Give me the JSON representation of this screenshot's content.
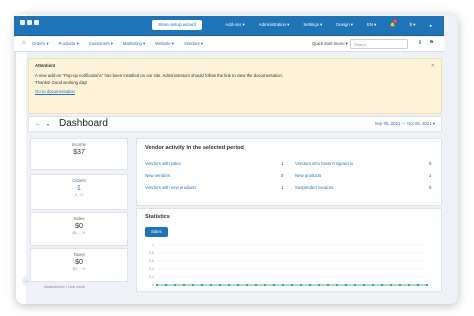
{
  "topbar": {
    "setup_button": "Store setup wizard",
    "items": [
      "Add-ons ▾",
      "Administration ▾",
      "Settings ▾",
      "Design ▾",
      "EN ▾"
    ],
    "currency": "$ ▾",
    "notification_count": "1"
  },
  "nav": {
    "items": [
      "Orders ▾",
      "Products ▾",
      "Customers ▾",
      "Marketing ▾",
      "Website ▾",
      "Vendors ▾"
    ],
    "quick_menu": "Quick start menu ▾",
    "search_placeholder": "Search"
  },
  "notice": {
    "title": "Attention!",
    "line1": "A new add-on \"Pop-up notifications\" has been installed on our site. Administrators should follow the link to view the documentation.",
    "line2": "Thanks! Good working day!",
    "link": "Go to documentation"
  },
  "dashboard": {
    "title": "Dashboard",
    "date_range": "Sep 05, 2021 — Oct 05, 2021 ▾"
  },
  "stats": [
    {
      "label": "Income",
      "value": "$37",
      "sub": ""
    },
    {
      "label": "Orders",
      "value": "1",
      "sub": "0, +1"
    },
    {
      "label": "Sales",
      "value": "$0",
      "sub": "$0, ...%"
    },
    {
      "label": "Taxes",
      "value": "$0",
      "sub": "$0, ...%"
    }
  ],
  "vendor_activity": {
    "title": "Vendor activity in the selected period",
    "rows_left": [
      {
        "label": "Vendors with sales",
        "value": "1"
      },
      {
        "label": "New vendors",
        "value": "0"
      },
      {
        "label": "Vendors with new products",
        "value": "1"
      }
    ],
    "rows_right": [
      {
        "label": "Vendors who haven't signed in",
        "value": "0"
      },
      {
        "label": "New products",
        "value": "1"
      },
      {
        "label": "Suspended vendors",
        "value": "0"
      }
    ]
  },
  "statistics": {
    "title": "Statistics",
    "tab": "Sales"
  },
  "chart_data": {
    "type": "line",
    "title": "",
    "y_ticks": [
      "1",
      "0.8",
      "0.6",
      "0.4",
      "0.2",
      "0"
    ],
    "ylim": [
      0,
      1
    ],
    "values": [
      0,
      0,
      0,
      0,
      0,
      0,
      0,
      0,
      0,
      0,
      0,
      0,
      0,
      0,
      0,
      0,
      0,
      0,
      0,
      0,
      0,
      0,
      0,
      0,
      0,
      0,
      0,
      0,
      0,
      0,
      0
    ],
    "colors": {
      "line": "#19a974"
    }
  },
  "footer": {
    "abandoned": "Abandoned / Live carts"
  }
}
